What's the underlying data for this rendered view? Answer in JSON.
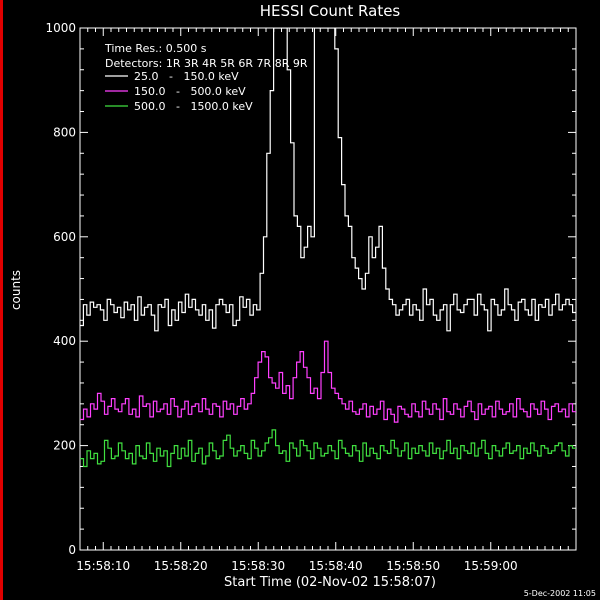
{
  "chart_data": {
    "type": "line",
    "title": "HESSI Count Rates",
    "xlabel": "Start Time (02-Nov-02 15:58:07)",
    "ylabel": "counts",
    "footer": "5-Dec-2002 11:05",
    "step": true,
    "xlim": [
      0,
      64
    ],
    "ylim": [
      0,
      1000
    ],
    "x_ticks": [
      {
        "t": 3,
        "label": "15:58:10"
      },
      {
        "t": 13,
        "label": "15:58:20"
      },
      {
        "t": 23,
        "label": "15:58:30"
      },
      {
        "t": 33,
        "label": "15:58:40"
      },
      {
        "t": 43,
        "label": "15:58:50"
      },
      {
        "t": 53,
        "label": "15:59:00"
      }
    ],
    "y_ticks": [
      0,
      200,
      400,
      600,
      800,
      1000
    ],
    "legend_info": [
      "Time Res.: 0.500 s",
      "Detectors: 1R 3R 4R 5R 6R 7R 8R 9R"
    ],
    "grid": false,
    "series": [
      {
        "name": "25.0   -   150.0 keV",
        "color": "#ffffff",
        "values": [
          430,
          470,
          450,
          475,
          465,
          470,
          460,
          440,
          480,
          470,
          455,
          465,
          445,
          475,
          460,
          470,
          440,
          485,
          450,
          465,
          470,
          450,
          420,
          470,
          465,
          480,
          430,
          460,
          440,
          475,
          455,
          490,
          465,
          480,
          460,
          450,
          470,
          440,
          460,
          425,
          470,
          480,
          470,
          455,
          470,
          430,
          440,
          485,
          465,
          480,
          450,
          470,
          460,
          530,
          600,
          760,
          880,
          1000,
          1000,
          1000,
          1000,
          920,
          780,
          640,
          620,
          560,
          580,
          620,
          600,
          1000,
          1000,
          1000,
          1000,
          1000,
          1000,
          960,
          790,
          700,
          640,
          620,
          560,
          540,
          520,
          500,
          530,
          600,
          560,
          580,
          620,
          540,
          500,
          480,
          470,
          450,
          460,
          470,
          480,
          450,
          470,
          460,
          440,
          500,
          470,
          480,
          450,
          440,
          460,
          470,
          420,
          470,
          490,
          460,
          455,
          470,
          480,
          480,
          450,
          490,
          470,
          460,
          420,
          480,
          470,
          450,
          460,
          500,
          470,
          460,
          440,
          475,
          480,
          460,
          450,
          480,
          440,
          470,
          465,
          480,
          450,
          470,
          490,
          460,
          470,
          480,
          470,
          455
        ]
      },
      {
        "name": "150.0   -   500.0 keV",
        "color": "#ff40ff",
        "values": [
          250,
          270,
          255,
          280,
          270,
          300,
          285,
          260,
          275,
          290,
          270,
          265,
          280,
          290,
          260,
          270,
          255,
          295,
          275,
          280,
          255,
          285,
          265,
          270,
          280,
          260,
          290,
          275,
          255,
          270,
          285,
          260,
          275,
          280,
          265,
          290,
          270,
          260,
          280,
          275,
          255,
          285,
          270,
          280,
          260,
          275,
          290,
          270,
          280,
          300,
          330,
          360,
          380,
          370,
          330,
          320,
          310,
          340,
          300,
          315,
          290,
          330,
          360,
          380,
          350,
          330,
          300,
          310,
          290,
          340,
          400,
          340,
          310,
          300,
          290,
          280,
          270,
          285,
          265,
          260,
          270,
          280,
          255,
          275,
          260,
          270,
          285,
          250,
          270,
          260,
          245,
          275,
          270,
          260,
          255,
          280,
          265,
          255,
          285,
          270,
          260,
          280,
          270,
          250,
          290,
          265,
          260,
          280,
          270,
          255,
          275,
          285,
          265,
          250,
          280,
          260,
          270,
          275,
          255,
          285,
          270,
          260,
          265,
          280,
          255,
          290,
          270,
          265,
          255,
          280,
          270,
          260,
          285,
          270,
          250,
          275,
          280,
          265,
          270,
          255,
          280,
          265
        ]
      },
      {
        "name": "500.0   -   1500.0 keV",
        "color": "#40e040",
        "values": [
          175,
          160,
          190,
          175,
          185,
          165,
          170,
          210,
          195,
          175,
          180,
          205,
          190,
          175,
          185,
          165,
          200,
          180,
          175,
          205,
          185,
          170,
          195,
          180,
          190,
          160,
          185,
          200,
          175,
          195,
          180,
          210,
          170,
          185,
          195,
          165,
          180,
          205,
          190,
          175,
          180,
          210,
          220,
          195,
          180,
          190,
          200,
          185,
          175,
          210,
          195,
          180,
          190,
          205,
          215,
          230,
          200,
          185,
          190,
          170,
          205,
          195,
          180,
          210,
          200,
          190,
          175,
          205,
          195,
          180,
          185,
          200,
          190,
          175,
          210,
          195,
          185,
          180,
          200,
          190,
          170,
          205,
          180,
          195,
          185,
          175,
          200,
          190,
          185,
          210,
          195,
          180,
          190,
          205,
          175,
          195,
          185,
          200,
          190,
          180,
          205,
          185,
          195,
          175,
          190,
          210,
          185,
          195,
          175,
          200,
          190,
          185,
          205,
          180,
          195,
          210,
          185,
          175,
          200,
          190,
          180,
          195,
          205,
          185,
          190,
          200,
          175,
          195,
          185,
          205,
          190,
          180,
          200,
          195,
          185,
          190,
          200,
          205,
          190,
          180,
          200,
          195
        ]
      }
    ]
  }
}
